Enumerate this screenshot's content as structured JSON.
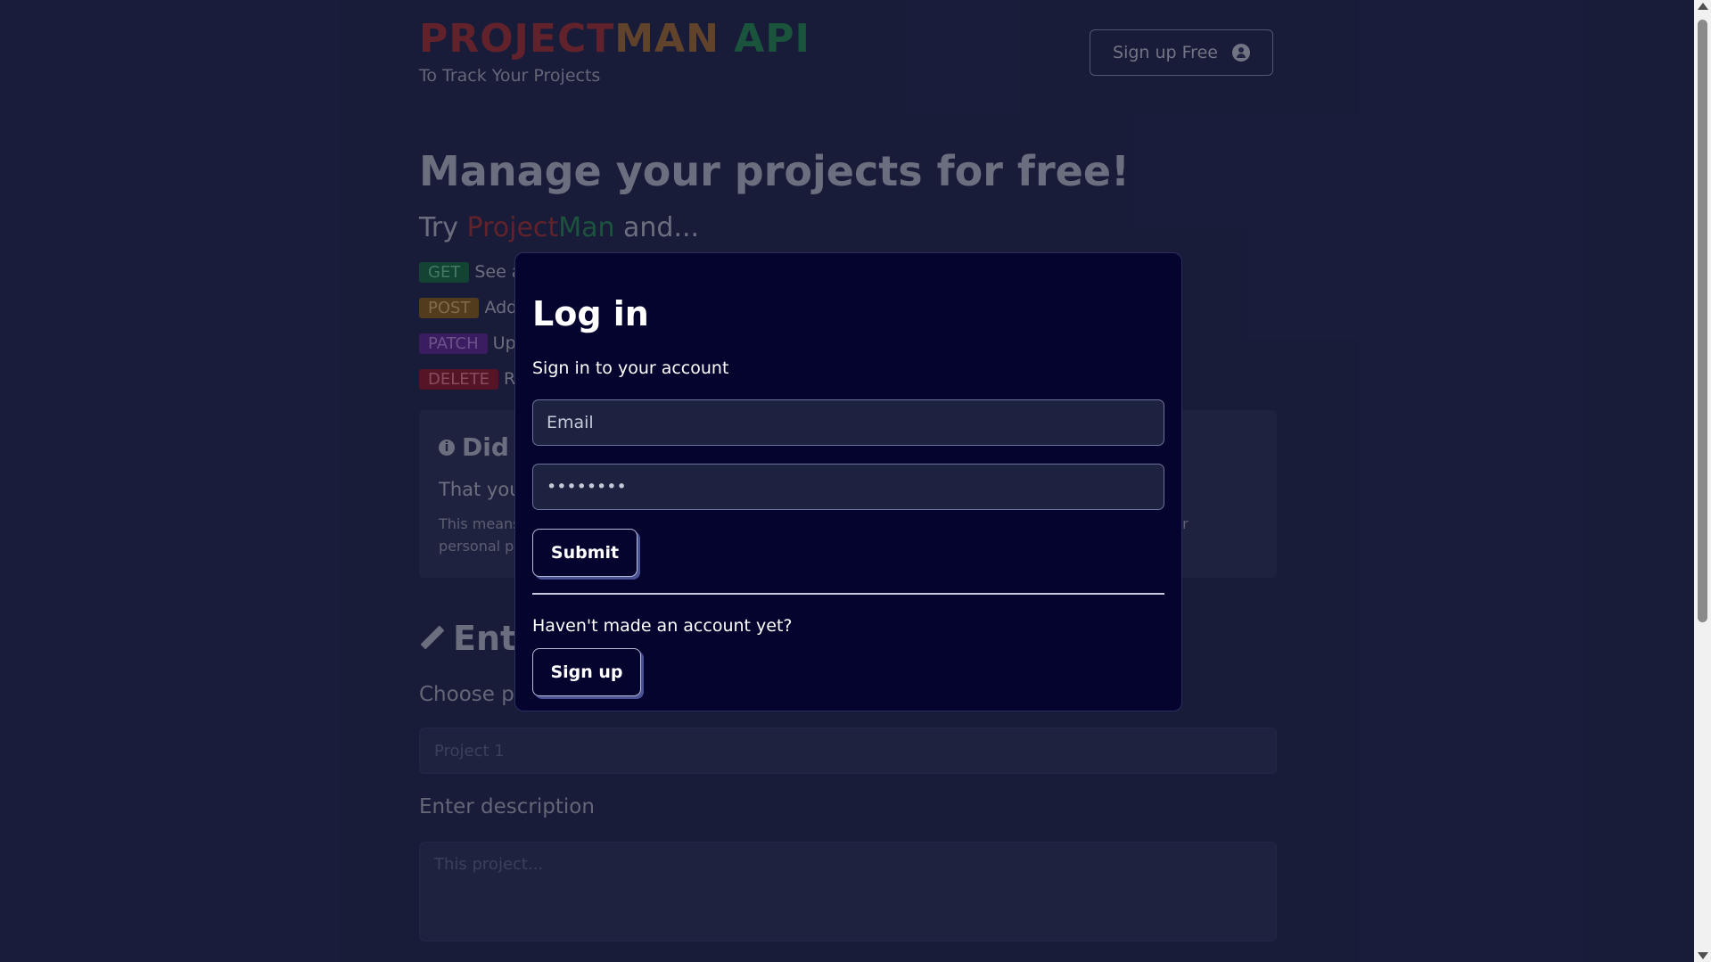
{
  "header": {
    "brand_part1": "PROJECT",
    "brand_part2": "MAN",
    "brand_part3": " API",
    "tagline": "To Track Your Projects",
    "signup_free_label": "Sign up Free",
    "signup_icon": "user-circle-icon"
  },
  "hero": {
    "headline": "Manage your projects for free!",
    "try_prefix": "Try ",
    "try_brand_a": "Project",
    "try_brand_b": "Man",
    "try_suffix": " and..."
  },
  "methods": [
    {
      "badge": "GET",
      "text": "See a"
    },
    {
      "badge": "POST",
      "text": "Add"
    },
    {
      "badge": "PATCH",
      "text": "Up"
    },
    {
      "badge": "DELETE",
      "text": "R"
    }
  ],
  "info_card": {
    "icon": "info-circle-icon",
    "title": "Did",
    "lead": "That you",
    "body_line1": "This means",
    "body_line1_end": "ur",
    "body_line2": "personal p"
  },
  "entry": {
    "icon": "pencil-icon",
    "title": "Ent",
    "choose_label": "Choose p",
    "project_placeholder": "Project 1",
    "description_label": "Enter description",
    "description_placeholder": "This project..."
  },
  "modal": {
    "title": "Log in",
    "subtitle": "Sign in to your account",
    "email_placeholder": "Email",
    "password_value": "••••••••",
    "submit_label": "Submit",
    "no_account_text": "Haven't made an account yet?",
    "signup_label": "Sign up"
  },
  "colors": {
    "page_bg": "#2a2f55",
    "modal_bg": "#04042f",
    "get": "#1f7a4a",
    "post": "#9a6a22",
    "patch": "#6a2fa0",
    "delete": "#a01f33"
  }
}
